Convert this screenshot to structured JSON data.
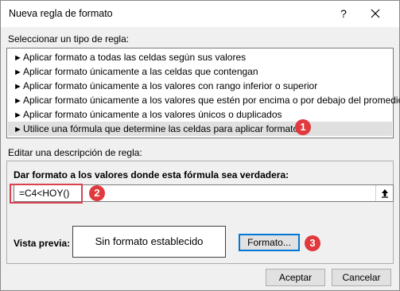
{
  "window": {
    "title": "Nueva regla de formato",
    "help_glyph": "?"
  },
  "rule_type": {
    "label": "Seleccionar un tipo de regla:",
    "items": [
      "Aplicar formato a todas las celdas según sus valores",
      "Aplicar formato únicamente a las celdas que contengan",
      "Aplicar formato únicamente a los valores con rango inferior o superior",
      "Aplicar formato únicamente a los valores que estén por encima o por debajo del promedio",
      "Aplicar formato únicamente a los valores únicos o duplicados",
      "Utilice una fórmula que determine las celdas para aplicar formato."
    ],
    "selected_index": 5,
    "arrow_glyph": "►"
  },
  "description": {
    "label": "Editar una descripción de regla:",
    "heading": "Dar formato a los valores donde esta fórmula sea verdadera:",
    "formula": "=C4<HOY()",
    "preview_label": "Vista previa:",
    "preview_text": "Sin formato establecido",
    "format_button": "Formato..."
  },
  "footer": {
    "accept": "Aceptar",
    "cancel": "Cancelar"
  },
  "callouts": [
    "1",
    "2",
    "3"
  ],
  "colors": {
    "callout": "#e03a3e",
    "highlight": "#d9434f",
    "focus": "#0078d7"
  }
}
